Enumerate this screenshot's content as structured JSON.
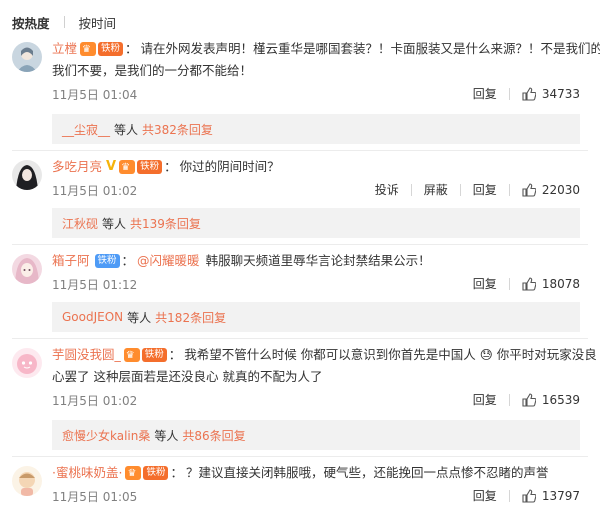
{
  "sort": {
    "hot": "按热度",
    "time": "按时间"
  },
  "actions": {
    "reply": "回复",
    "report": "投诉",
    "block": "屏蔽"
  },
  "comments": [
    {
      "name": "立樘",
      "fan_badge": "铁粉",
      "line1": "请在外网发表声明！槿云重华是哪国套装？！卡面服装又是什么来源？！不是我们的",
      "line2": "我们不要，是我们的一分都不能给！",
      "time": "11月5日 01:04",
      "likes": "34733",
      "reply_name": "__尘寂__",
      "reply_mid": "等人",
      "reply_count": "共382条回复"
    },
    {
      "name": "多吃月亮",
      "fan_badge": "铁粉",
      "line1": "你过的阴间时间？",
      "time": "11月5日 01:02",
      "likes": "22030",
      "reply_name": "江秋砚",
      "reply_mid": "等人",
      "reply_count": "共139条回复"
    },
    {
      "name": "箱子阿",
      "fan_badge": "铁粉",
      "mention": "@闪耀暖暖",
      "line1": "韩服聊天频道里辱华言论封禁结果公示！",
      "time": "11月5日 01:12",
      "likes": "18078",
      "reply_name": "GoodJEON",
      "reply_mid": "等人",
      "reply_count": "共182条回复"
    },
    {
      "name": "芋圆没我圆_",
      "fan_badge": "铁粉",
      "line1": "我希望不管什么时候 你都可以意识到你首先是中国人 😓 你平时对玩家没良",
      "line2": "心罢了 这种层面若是还没良心 就真的不配为人了",
      "time": "11月5日 01:02",
      "likes": "16539",
      "reply_name": "愈慢少女kalin桑",
      "reply_mid": "等人",
      "reply_count": "共86条回复"
    },
    {
      "name": "·蜜桃味奶盖·",
      "fan_badge": "铁粉",
      "line1": "？建议直接关闭韩服哦，硬气些，还能挽回一点点惨不忍睹的声誉",
      "time": "11月5日 01:05",
      "likes": "13797"
    }
  ]
}
